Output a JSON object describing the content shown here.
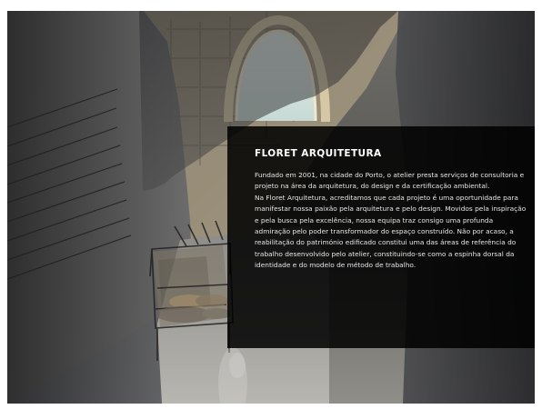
{
  "hero": {
    "title": "FLORET ARQUITETURA",
    "paragraph_1": "Fundado em 2001, na cidade do Porto, o atelier presta serviços de consultoria e projeto na área da arquitetura, do design e da certificação ambiental.",
    "paragraph_2": "Na Floret Arquitetura, acreditamos que cada projeto é uma oportunidade para manifestar nossa paixão pela arquitetura e pelo design. Movidos pela inspiração e pela busca pela excelência, nossa equipa traz consigo uma profunda admiração pelo poder transformador do espaço construído. Não por acaso, a reabilitação do património edificado constitui uma das áreas de referência do trabalho desenvolvido pelo atelier, constituindo-se como a espinha dorsal da identidade e do modelo de método de trabalho."
  },
  "colors": {
    "overlay": "#000000",
    "text": "#ffffff",
    "stone": "#8b7f6a",
    "wall": "#6b6d6f",
    "sky": "#dbe8e4"
  },
  "icons": []
}
